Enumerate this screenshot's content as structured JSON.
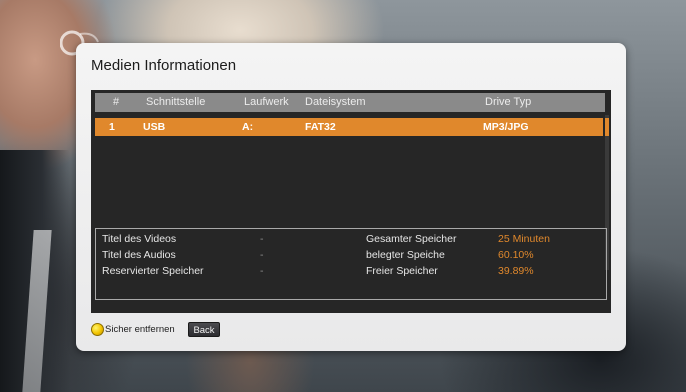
{
  "dialog": {
    "title": "Medien Informationen"
  },
  "table": {
    "headers": [
      "#",
      "Schnittstelle",
      "Laufwerk",
      "Dateisystem",
      "Drive Typ"
    ],
    "rows": [
      {
        "index": "1",
        "interface": "USB",
        "drive": "A:",
        "filesystem": "FAT32",
        "type": "MP3/JPG"
      }
    ]
  },
  "info": {
    "left": [
      {
        "label": "Titel des Videos",
        "value": "-"
      },
      {
        "label": "Titel des Audios",
        "value": "-"
      },
      {
        "label": "Reservierter Speicher",
        "value": "-"
      }
    ],
    "right": [
      {
        "label": "Gesamter Speicher",
        "value": "25 Minuten"
      },
      {
        "label": "belegter Speiche",
        "value": "60.10%"
      },
      {
        "label": "Freier Speicher",
        "value": "39.89%"
      }
    ]
  },
  "footer": {
    "remove_label": "Sicher entfernen",
    "back_label": "Back"
  },
  "colors": {
    "accent": "#e0882c",
    "yellow_key": "#f3c400"
  }
}
